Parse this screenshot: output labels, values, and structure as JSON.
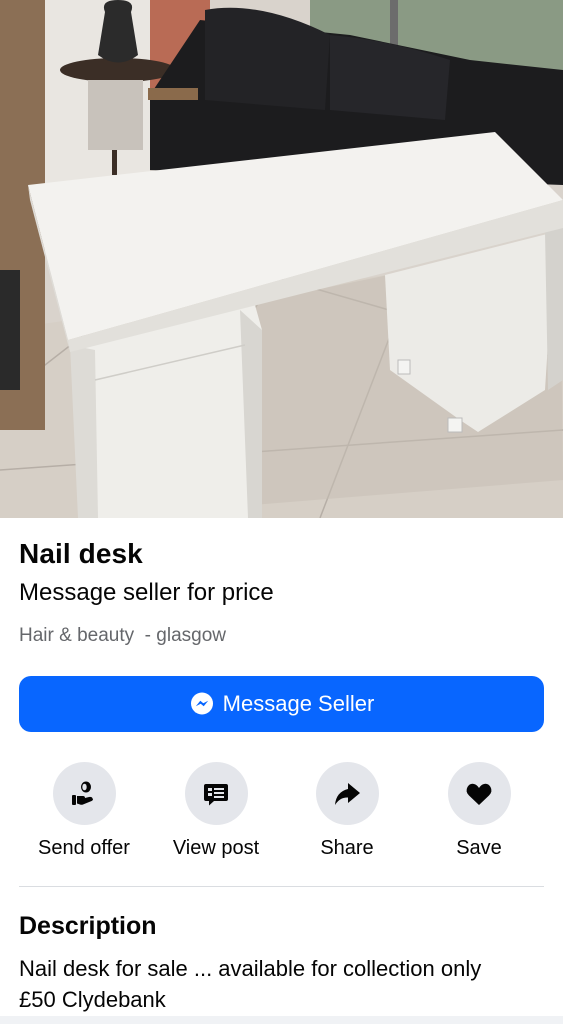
{
  "listing": {
    "title": "Nail desk",
    "price": "Message seller for price",
    "category": "Hair & beauty",
    "location_separator": "  - ",
    "location": "glasgow"
  },
  "primary_action": {
    "label": "Message Seller",
    "icon": "messenger-icon",
    "color": "#0866ff"
  },
  "actions": [
    {
      "label": "Send offer",
      "icon": "hand-offer-icon"
    },
    {
      "label": "View post",
      "icon": "post-icon"
    },
    {
      "label": "Share",
      "icon": "share-arrow-icon"
    },
    {
      "label": "Save",
      "icon": "heart-icon"
    }
  ],
  "description": {
    "heading": "Description",
    "lines": [
      "Nail desk for sale ... available for collection only",
      "£50 Clydebank"
    ]
  }
}
